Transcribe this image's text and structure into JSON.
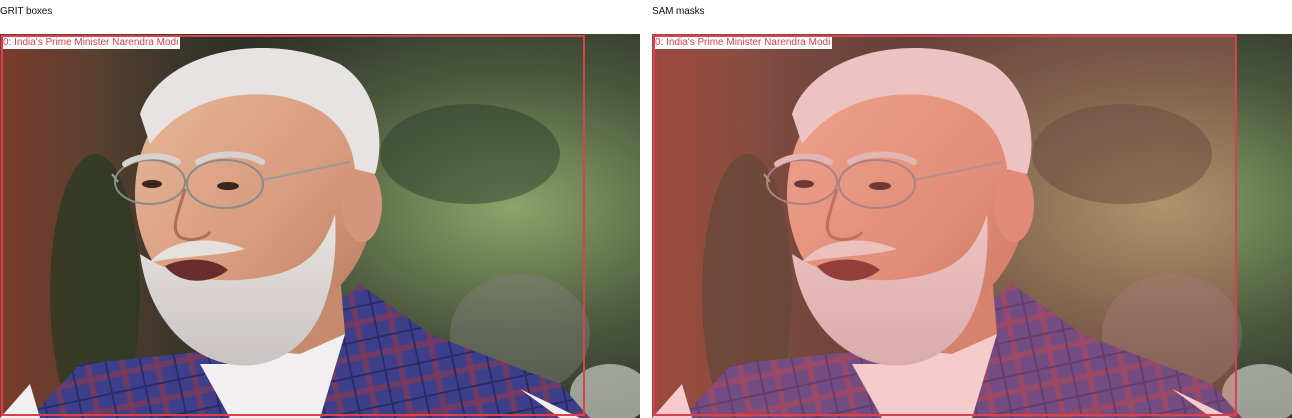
{
  "panels": [
    {
      "title": "GRIT boxes",
      "box_label": "0: India's Prime Minister Narendra Modi",
      "mask_overlay": false
    },
    {
      "title": "SAM masks",
      "box_label": "0: India's Prime Minister Narendra Modi",
      "mask_overlay": true
    }
  ],
  "colors": {
    "box": "#d9414f",
    "mask": "#ff6e6e"
  }
}
